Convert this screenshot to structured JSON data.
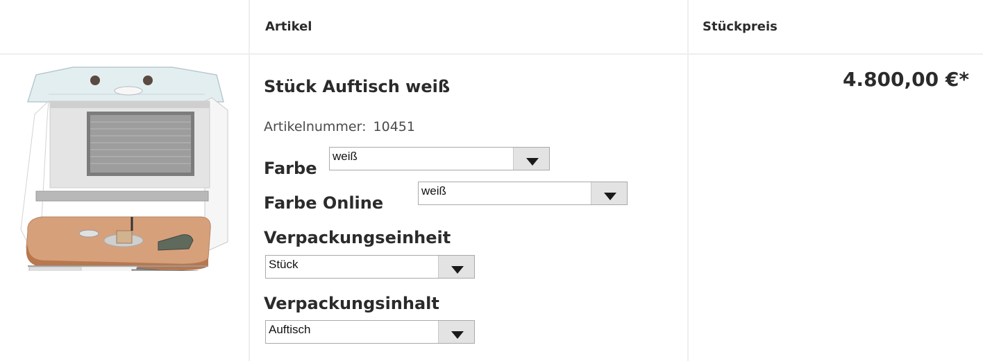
{
  "header": {
    "col_article": "Artikel",
    "col_unit_price": "Stückpreis"
  },
  "product": {
    "title": "Stück Auftisch weiß",
    "article_number_label": "Artikelnummer:",
    "article_number": "10451",
    "price": "4.800,00 €*",
    "options": {
      "farbe": {
        "label": "Farbe",
        "selected": "weiß"
      },
      "farbe_online": {
        "label": "Farbe Online",
        "selected": "weiß"
      },
      "verpackungseinheit": {
        "label": "Verpackungseinheit",
        "selected": "Stück"
      },
      "verpackungsinhalt": {
        "label": "Verpackungsinhalt",
        "selected": "Auftisch"
      }
    }
  }
}
